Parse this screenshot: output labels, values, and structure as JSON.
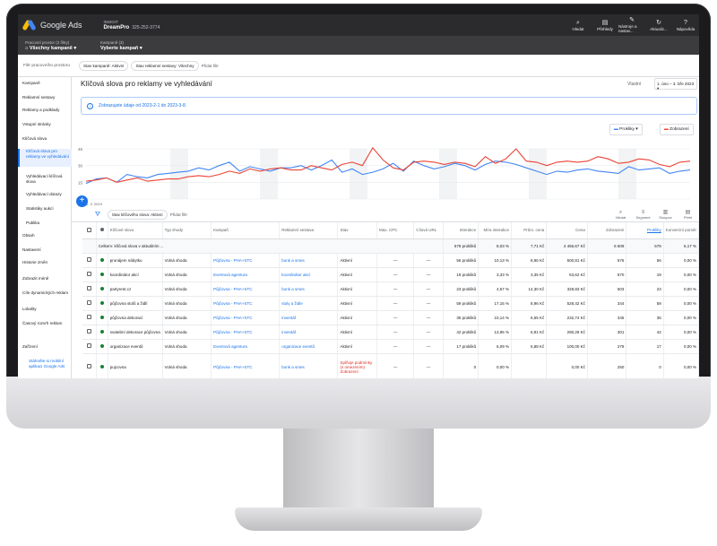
{
  "topbar": {
    "product": "Google Ads",
    "account_label": "INSIGIT",
    "account_name": "DreamPro",
    "account_id": "325-252-3774",
    "tools": [
      {
        "icon": "search-icon",
        "label": "Hledat"
      },
      {
        "icon": "report-icon",
        "label": "Přehledy"
      },
      {
        "icon": "wrench-icon",
        "label": "Nástroje a nastav..."
      },
      {
        "icon": "refresh-icon",
        "label": "Aktualiz..."
      },
      {
        "icon": "help-icon",
        "label": "Nápověda"
      }
    ]
  },
  "filterbar": {
    "ws_label": "Pracovní prostor (2 filtry)",
    "ws_value": "Všechny kampaně",
    "campaign_label": "Kampaně (3)",
    "campaign_value": "Vyberte kampaň"
  },
  "workspace": {
    "label": "Filtr pracovního prostoru",
    "chips": [
      "Stav kampaně: Aktivní",
      "Stav reklamní sestavy: Všechny"
    ],
    "add": "Přidat filtr"
  },
  "sidebar": {
    "items": [
      "Kampaně",
      "Reklamní sestavy",
      "Reklamy a podklady",
      "Vstupní stránky",
      "Klíčová slova",
      "Klíčová slova pro reklamy ve vyhledávání",
      "Vyhledávací klíčová slova",
      "Vyhledávací dotazy",
      "Statistiky aukcí",
      "Publika",
      "Obsah",
      "Nastavení",
      "Historie změn",
      "Zobrazit méně",
      "Cíle dynamických reklam",
      "Lokality",
      "Časový rozvrh reklam",
      "Zařízení",
      "Stáhněte si mobilní aplikaci Google Ads"
    ]
  },
  "main": {
    "title": "Klíčová slova pro reklamy ve vyhledávání",
    "showing_label": "Vlastní",
    "date_range": "1. úno – 3. bře 2023",
    "info": "Zobrazujete údaje od 2023-2-1 do 2023-3-8.",
    "metric1": "Prokliky",
    "metric2": "Zobrazení",
    "add_button": "+"
  },
  "chart_data": {
    "type": "line",
    "y_ticks": [
      "45",
      "30",
      "15",
      "0"
    ],
    "x_start_label": "1. 3. 2023",
    "series": [
      {
        "name": "Prokliky",
        "color": "#4285f4",
        "values": [
          14,
          18,
          19,
          15,
          22,
          20,
          19,
          22,
          23,
          24,
          25,
          28,
          26,
          30,
          33,
          25,
          29,
          27,
          25,
          28,
          28,
          30,
          26,
          30,
          35,
          24,
          27,
          22,
          24,
          27,
          32,
          25,
          34,
          30,
          27,
          29,
          32,
          30,
          26,
          31,
          34,
          33,
          31,
          28,
          25,
          22,
          25,
          24,
          26,
          27,
          25,
          24,
          23,
          29,
          26,
          27,
          28,
          23,
          25,
          26
        ]
      },
      {
        "name": "Zobrazení",
        "color": "#ea4335",
        "values": [
          16,
          17,
          19,
          15,
          17,
          19,
          16,
          17,
          18,
          18,
          20,
          21,
          20,
          22,
          25,
          23,
          27,
          25,
          27,
          28,
          26,
          26,
          30,
          28,
          26,
          31,
          33,
          30,
          46,
          35,
          28,
          26,
          33,
          34,
          33,
          31,
          33,
          32,
          29,
          38,
          32,
          36,
          45,
          34,
          33,
          30,
          33,
          34,
          33,
          34,
          38,
          36,
          32,
          33,
          36,
          35,
          31,
          29,
          33,
          34
        ]
      }
    ]
  },
  "table": {
    "toolbar": {
      "filter_chip": "Stav klíčového slova: Aktivní",
      "add_filter": "Přidat filtr",
      "buttons": [
        "Hledat",
        "Segment",
        "Sloupce",
        "Přehl"
      ]
    },
    "headers": [
      "Klíčové slovo",
      "Typ shody",
      "Kampaň",
      "Reklamní sestava",
      "Stav",
      "Max. CPC",
      "Cílová URL",
      "Interakce",
      "Míra interakce",
      "Prům. cena",
      "Cena",
      "Zobrazení",
      "Prokliky",
      "Konverzní poměr"
    ],
    "total": {
      "label": "Celkem: klíčová slova v aktuálním ...",
      "interakce": "578 prokliků",
      "mira": "8,03 %",
      "prum": "7,71 Kč",
      "cena": "4 456,67 Kč",
      "zobr": "6 509",
      "prokliky": "578",
      "konv": "6,17 %"
    },
    "rows": [
      {
        "kw": "pronájem nábytku",
        "typ": "Volná shoda",
        "kampan": "Půjčovna - PHA+STC",
        "sestava": "bonk a smes",
        "stav": "Aktivní",
        "cpc": "—",
        "url": "—",
        "interakce": "56 prokliků",
        "mira": "10,13 %",
        "prum": "8,96 Kč",
        "cena": "500,81 Kč",
        "zobr": "576",
        "prokliky": "56",
        "konv": "0,00 %"
      },
      {
        "kw": "koordinátor akcí",
        "typ": "Volná shoda",
        "kampan": "Eventová agentura",
        "sestava": "koordinátor akcí",
        "stav": "Aktivní",
        "cpc": "—",
        "url": "—",
        "interakce": "19 prokliků",
        "mira": "3,33 %",
        "prum": "3,35 Kč",
        "cena": "63,62 Kč",
        "zobr": "570",
        "prokliky": "19",
        "konv": "0,00 %"
      },
      {
        "kw": "partyrent.cz",
        "typ": "Volná shoda",
        "kampan": "Půjčovna - PHA+STC",
        "sestava": "bonk a smes",
        "stav": "Aktivní",
        "cpc": "—",
        "url": "—",
        "interakce": "23 prokliků",
        "mira": "4,57 %",
        "prum": "14,30 Kč",
        "cena": "328,83 Kč",
        "zobr": "503",
        "prokliky": "23",
        "konv": "0,00 %"
      },
      {
        "kw": "půjčovna stolů a židlí",
        "typ": "Volná shoda",
        "kampan": "Půjčovna - PHA+STC",
        "sestava": "stoly a židle",
        "stav": "Aktivní",
        "cpc": "—",
        "url": "—",
        "interakce": "59 prokliků",
        "mira": "17,15 %",
        "prum": "8,96 Kč",
        "cena": "528,42 Kč",
        "zobr": "344",
        "prokliky": "59",
        "konv": "0,00 %"
      },
      {
        "kw": "půjčovna dekorací",
        "typ": "Volná shoda",
        "kampan": "Půjčovna - PHA+STC",
        "sestava": "inventář",
        "stav": "Aktivní",
        "cpc": "—",
        "url": "—",
        "interakce": "35 prokliků",
        "mira": "10,14 %",
        "prum": "6,65 Kč",
        "cena": "232,74 Kč",
        "zobr": "345",
        "prokliky": "35",
        "konv": "0,00 %"
      },
      {
        "kw": "svatební dekorace půjčovna",
        "typ": "Volná shoda",
        "kampan": "Půjčovna - PHA+STC",
        "sestava": "inventář",
        "stav": "Aktivní",
        "cpc": "—",
        "url": "—",
        "interakce": "42 prokliků",
        "mira": "13,95 %",
        "prum": "6,91 Kč",
        "cena": "290,29 Kč",
        "zobr": "301",
        "prokliky": "42",
        "konv": "0,00 %"
      },
      {
        "kw": "organizace eventů",
        "typ": "Volná shoda",
        "kampan": "Eventová agentura",
        "sestava": "organizace eventů",
        "stav": "Aktivní",
        "cpc": "—",
        "url": "—",
        "interakce": "17 prokliků",
        "mira": "6,09 %",
        "prum": "5,88 Kč",
        "cena": "100,00 Kč",
        "zobr": "279",
        "prokliky": "17",
        "konv": "0,00 %"
      },
      {
        "kw": "pujcovna",
        "typ": "Volná shoda",
        "kampan": "Půjčovna - PHA+STC",
        "sestava": "bonk a smes",
        "stav": "Splňuje podmínky (s omezením) Zobrazení",
        "cpc": "—",
        "url": "—",
        "interakce": "0",
        "mira": "0,00 %",
        "prum": "",
        "cena": "0,00 Kč",
        "zobr": "250",
        "prokliky": "0",
        "konv": "0,00 %"
      }
    ]
  }
}
